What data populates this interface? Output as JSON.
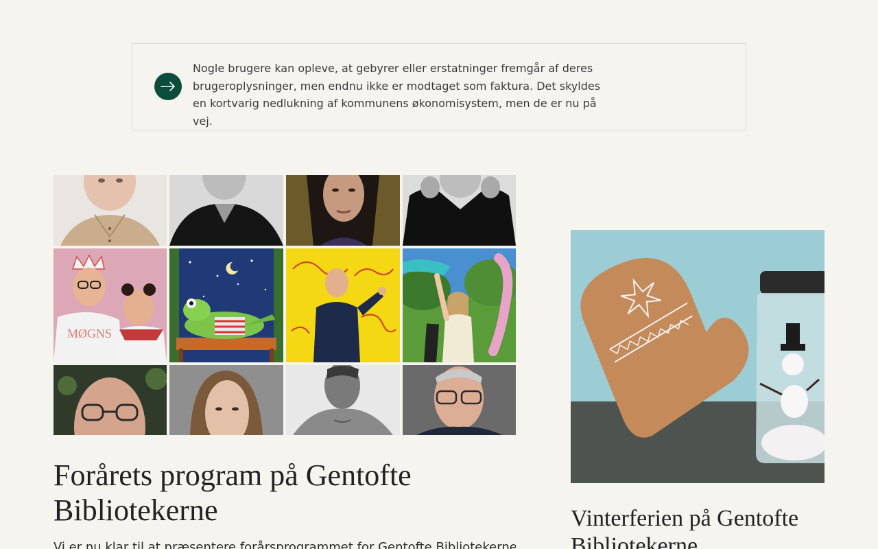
{
  "notice": {
    "text": "Nogle brugere kan opleve, at gebyrer eller erstatninger fremgår af deres brugeroplysninger, men endnu ikke er modtaget som faktura. Det skyldes en kortvarig nedlukning af kommunens økonomisystem, men de er nu på vej.",
    "icon": "arrow-right-icon",
    "accent": "#0b4d3a"
  },
  "articles": [
    {
      "title": "Forårets program på Gentofte Bibliotekerne",
      "excerpt": "Vi er nu klar til at præsentere forårsprogrammet for Gentofte Bibliotekerne, og"
    },
    {
      "title": "Vinterferien på Gentofte Bibliotekerne"
    }
  ],
  "colors": {
    "background": "#f6f4ef",
    "border": "#dcdad4",
    "text": "#2b2b2b"
  }
}
